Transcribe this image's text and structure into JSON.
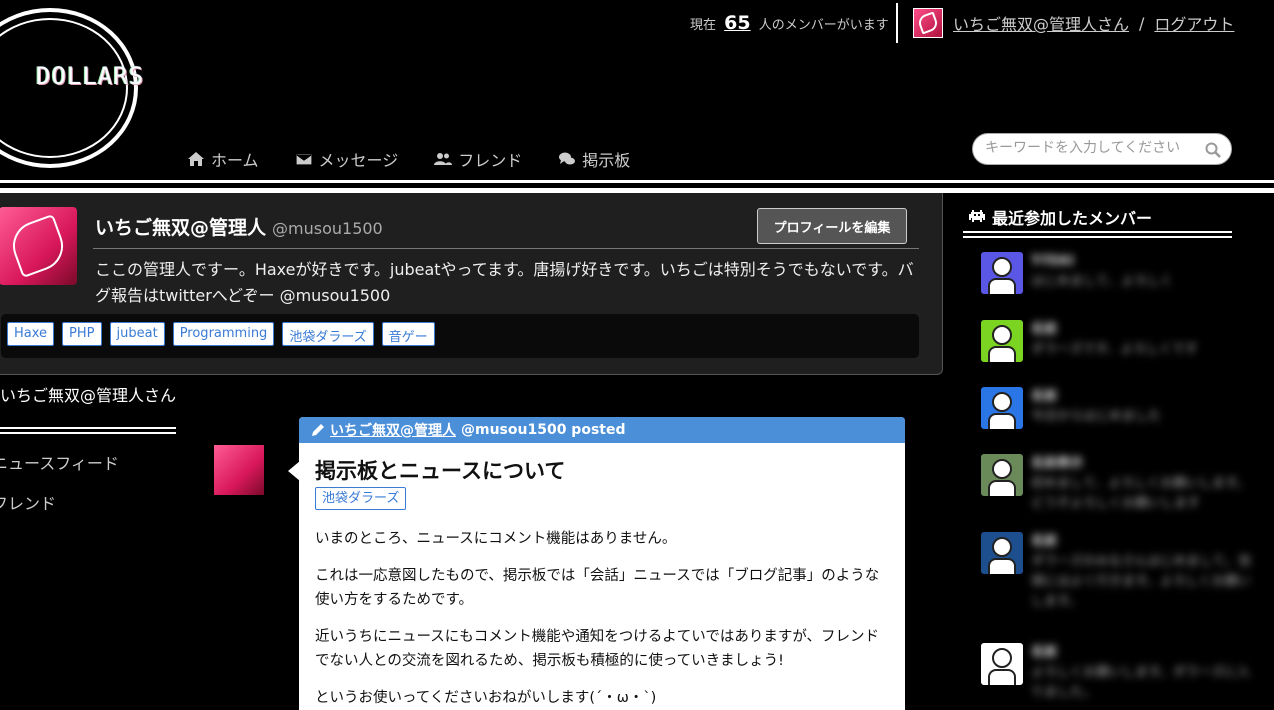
{
  "header": {
    "logo_text": "DOLLARS",
    "member_count_prefix": "現在",
    "member_count": "65",
    "member_count_suffix": "人のメンバーがいます",
    "user_name": "いちご無双@管理人さん",
    "separator": "/",
    "logout": "ログアウト"
  },
  "nav": [
    {
      "label": "ホーム",
      "icon": "home-icon"
    },
    {
      "label": "メッセージ",
      "icon": "mail-icon"
    },
    {
      "label": "フレンド",
      "icon": "users-icon"
    },
    {
      "label": "掲示板",
      "icon": "comments-icon"
    }
  ],
  "search": {
    "placeholder": "キーワードを入力してください"
  },
  "profile": {
    "name": "いちご無双@管理人",
    "handle": "@musou1500",
    "edit_button": "プロフィールを編集",
    "bio": "ここの管理人ですー。Haxeが好きです。jubeatやってます。唐揚げ好きです。いちごは特別そうでもないです。バグ報告はtwitterへどぞー @musou1500",
    "tags": [
      "Haxe",
      "PHP",
      "jubeat",
      "Programming",
      "池袋ダラーズ",
      "音ゲー"
    ]
  },
  "left_menu": {
    "title": "いちご無双@管理人さん",
    "items": [
      "ニュースフィード",
      "フレンド"
    ]
  },
  "post": {
    "author": "いちご無双@管理人",
    "author_meta": "@musou1500 posted",
    "title": "掲示板とニュースについて",
    "tag": "池袋ダラーズ",
    "paragraphs": [
      "いまのところ、ニュースにコメント機能はありません。",
      "これは一応意図したもので、掲示板では「会話」ニュースでは「ブログ記事」のような使い方をするためです。",
      "近いうちにニュースにもコメント機能や通知をつけるよていではありますが、フレンドでない人との交流を図れるため、掲示板も積極的に使っていきましょう!",
      "というお使いってくださいおねがいします(´・ω・`)"
    ]
  },
  "recent_members": {
    "title": "最近参加したメンバー",
    "members": [
      {
        "name": "T-TEKI",
        "desc": "はじめまして、よろしく",
        "color": "#5b57e6"
      },
      {
        "name": "名前",
        "desc": "ダラーズです、よろしくです",
        "color": "#7bd421"
      },
      {
        "name": "名前",
        "desc": "今日からはじめました",
        "color": "#2a76e6"
      },
      {
        "name": "名前表示",
        "desc": "初めまして、よろしくお願いします。どうぞよろしくお願いします",
        "color": "#6b8a5a"
      },
      {
        "name": "名前",
        "desc": "ダラーズのみなさんはじめまして。池袋にはよく行きます。よろしくお願いします。",
        "color": "#1d4f8f"
      },
      {
        "name": "名前",
        "desc": "よろしくお願いします。ダラーズに入りました。",
        "color": "#ffffff"
      }
    ]
  },
  "colors": {
    "accent": "#4b8fd8",
    "tag": "#3a7bd5",
    "panel": "#1f1f1f"
  }
}
